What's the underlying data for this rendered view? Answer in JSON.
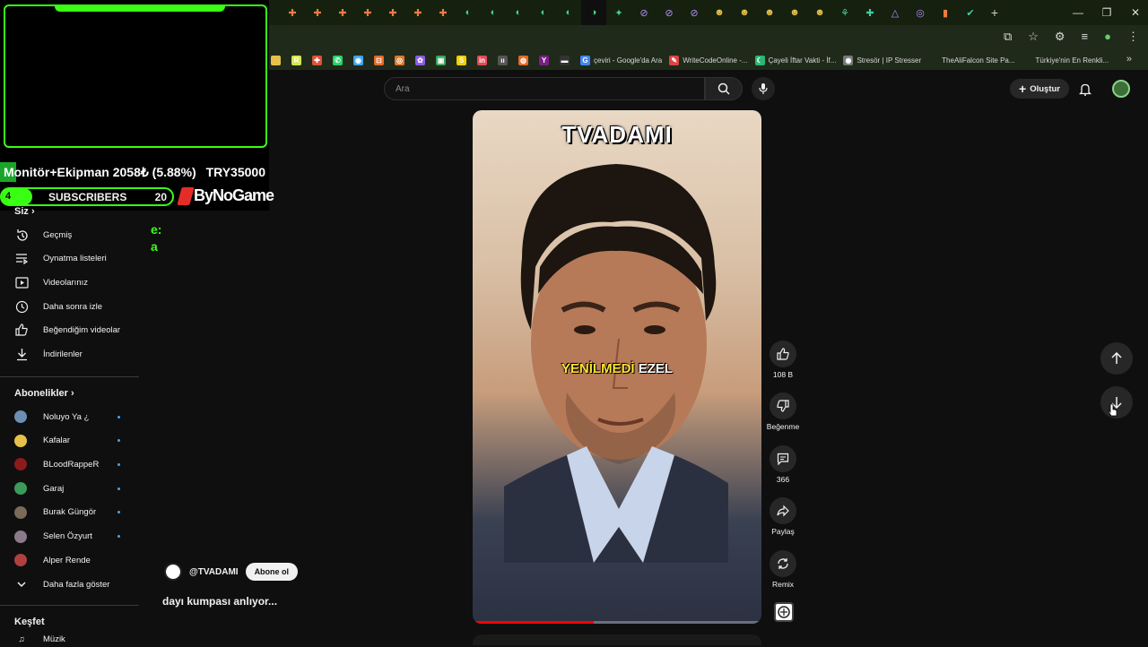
{
  "browser": {
    "tabs": [
      {
        "icon": "✚",
        "style": ""
      },
      {
        "icon": "✚",
        "style": ""
      },
      {
        "icon": "✚",
        "style": ""
      },
      {
        "icon": "✚",
        "style": ""
      },
      {
        "icon": "✚",
        "style": ""
      },
      {
        "icon": "✚",
        "style": ""
      },
      {
        "icon": "✚",
        "style": ""
      },
      {
        "icon": "◐",
        "style": "t-green"
      },
      {
        "icon": "◐",
        "style": "t-green"
      },
      {
        "icon": "◐",
        "style": "t-green"
      },
      {
        "icon": "◐",
        "style": "t-green"
      },
      {
        "icon": "◐",
        "style": "t-green"
      },
      {
        "icon": "◑",
        "style": "active"
      },
      {
        "icon": "✦",
        "style": "t-green"
      },
      {
        "icon": "⊘",
        "style": "t-purple"
      },
      {
        "icon": "⊘",
        "style": "t-purple"
      },
      {
        "icon": "⊘",
        "style": "t-purple"
      },
      {
        "icon": "☻",
        "style": "t-yellow"
      },
      {
        "icon": "☻",
        "style": "t-yellow"
      },
      {
        "icon": "☻",
        "style": "t-yellow"
      },
      {
        "icon": "☻",
        "style": "t-yellow"
      },
      {
        "icon": "☻",
        "style": "t-yellow"
      },
      {
        "icon": "⚘",
        "style": "t-green"
      },
      {
        "icon": "✚",
        "style": "t-green"
      },
      {
        "icon": "△",
        "style": "t-purple"
      },
      {
        "icon": "◎",
        "style": "t-purple"
      },
      {
        "icon": "▮",
        "style": ""
      },
      {
        "icon": "✔",
        "style": "t-green"
      }
    ],
    "new_tab": "+",
    "window_controls": {
      "minimize": "—",
      "maximize": "❐",
      "close": "✕"
    },
    "bookmarks": [
      {
        "label": "",
        "color": "#e6c14a",
        "glyph": ""
      },
      {
        "label": "",
        "color": "#d7e84a",
        "glyph": "R"
      },
      {
        "label": "",
        "color": "#e0503a",
        "glyph": "✚"
      },
      {
        "label": "",
        "color": "#25d366",
        "glyph": "✆"
      },
      {
        "label": "",
        "color": "#3ea6ff",
        "glyph": "◉"
      },
      {
        "label": "",
        "color": "#e86a2b",
        "glyph": "⊡"
      },
      {
        "label": "",
        "color": "#e07a2a",
        "glyph": "◎"
      },
      {
        "label": "",
        "color": "#8a5ce6",
        "glyph": "✿"
      },
      {
        "label": "",
        "color": "#3ba55d",
        "glyph": "▣"
      },
      {
        "label": "",
        "color": "#f0d000",
        "glyph": "S"
      },
      {
        "label": "",
        "color": "#e34a5a",
        "glyph": "in"
      },
      {
        "label": "",
        "color": "#555555",
        "glyph": "ıı"
      },
      {
        "label": "",
        "color": "#e86a2b",
        "glyph": "◍"
      },
      {
        "label": "",
        "color": "#7a1f86",
        "glyph": "Y"
      },
      {
        "label": "",
        "color": "#333333",
        "glyph": "▬"
      },
      {
        "label": "çeviri - Google'da Ara",
        "color": "#4285f4",
        "glyph": "G"
      },
      {
        "label": "WriteCodeOnline -...",
        "color": "#d44",
        "glyph": "✎"
      },
      {
        "label": "Çayeli İftar Vakti - İf...",
        "color": "#2bb673",
        "glyph": "☾"
      },
      {
        "label": "Stresör | IP Stresser",
        "color": "#777777",
        "glyph": "◉"
      },
      {
        "label": "TheAliFalcon Site Pa...",
        "color": "#1f2a1a",
        "glyph": ""
      },
      {
        "label": "Türkiye'nin En Renkli...",
        "color": "#1f2a1a",
        "glyph": ""
      }
    ],
    "more_bookmarks": "»"
  },
  "overlay": {
    "ticker_left": "Monitör+Ekipman 2058₺ (5.88%)",
    "ticker_right": "TRY35000",
    "subs_left_count": "4",
    "subs_label": "SUBSCRIBERS",
    "subs_count": "20",
    "brand": "ByNoGame",
    "green_line1": "e:",
    "green_line2": "a"
  },
  "header": {
    "search_placeholder": "Ara",
    "create_label": "Oluştur"
  },
  "sidebar": {
    "you_label": "Siz",
    "you_items": [
      {
        "label": "Geçmiş",
        "icon": "history-icon"
      },
      {
        "label": "Oynatma listeleri",
        "icon": "playlists-icon"
      },
      {
        "label": "Videolarınız",
        "icon": "your-videos-icon"
      },
      {
        "label": "Daha sonra izle",
        "icon": "watch-later-icon"
      },
      {
        "label": "Beğendiğim videolar",
        "icon": "liked-videos-icon"
      },
      {
        "label": "İndirilenler",
        "icon": "downloads-icon"
      }
    ],
    "subscriptions_label": "Abonelikler",
    "subscriptions": [
      {
        "label": "Noluyo Ya ¿",
        "color": "#6a8fb0",
        "new": true
      },
      {
        "label": "Kafalar",
        "color": "#e6c14a",
        "new": true
      },
      {
        "label": "BLoodRappeR",
        "color": "#8a1c1c",
        "new": true
      },
      {
        "label": "Garaj",
        "color": "#3c9a5a",
        "new": true
      },
      {
        "label": "Burak Güngör",
        "color": "#7a6a5a",
        "new": true
      },
      {
        "label": "Selen Özyurt",
        "color": "#8a7a8a",
        "new": true
      },
      {
        "label": "Alper Rende",
        "color": "#b04040",
        "new": false
      }
    ],
    "show_more": "Daha fazla göster",
    "explore_label": "Keşfet",
    "explore_first": "Müzik"
  },
  "short": {
    "title_overlay": "TVADAMI",
    "caption_yellow": "YENİLMEDİ",
    "caption_white": "EZEL",
    "progress": 0.42,
    "channel": "@TVADAMI",
    "subscribe_label": "Abone ol",
    "description": "dayı kumpası anlıyor...",
    "likes": "108 B",
    "dislike_label": "Beğenme",
    "comments": "366",
    "share_label": "Paylaş",
    "remix_label": "Remix"
  },
  "colors": {
    "accent_green": "#39ff14",
    "yt_red": "#ff0000",
    "bg": "#0f0f0f"
  }
}
